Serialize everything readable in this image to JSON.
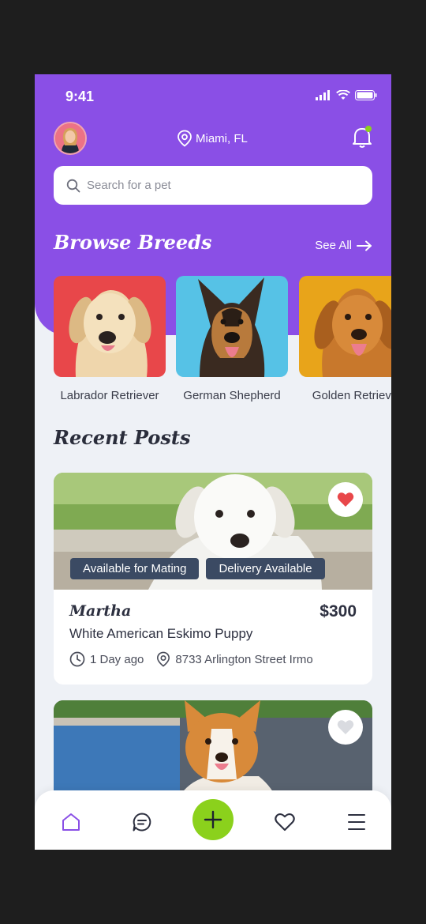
{
  "status_bar": {
    "time": "9:41"
  },
  "header": {
    "location": "Miami, FL"
  },
  "search": {
    "placeholder": "Search for a pet"
  },
  "browse": {
    "title": "Browse Breeds",
    "see_all": "See All",
    "breeds": [
      {
        "name": "Labrador Retriever",
        "bg": "#e8474a"
      },
      {
        "name": "German Shepherd",
        "bg": "#56c2e6"
      },
      {
        "name": "Golden Retrieve",
        "bg": "#e8a41a"
      }
    ]
  },
  "recent": {
    "title": "Recent Posts",
    "posts": [
      {
        "tags": [
          "Available for Mating",
          "Delivery Available"
        ],
        "owner": "Martha",
        "price": "$300",
        "title": "White American Eskimo Puppy",
        "time": "1 Day ago",
        "address": "8733 Arlington Street Irmo",
        "liked": true
      },
      {
        "liked": false
      }
    ]
  },
  "colors": {
    "primary": "#8a4fe6",
    "accent": "#8bd11c",
    "heart": "#e8474a",
    "tag_bg": "#3b4a63"
  }
}
